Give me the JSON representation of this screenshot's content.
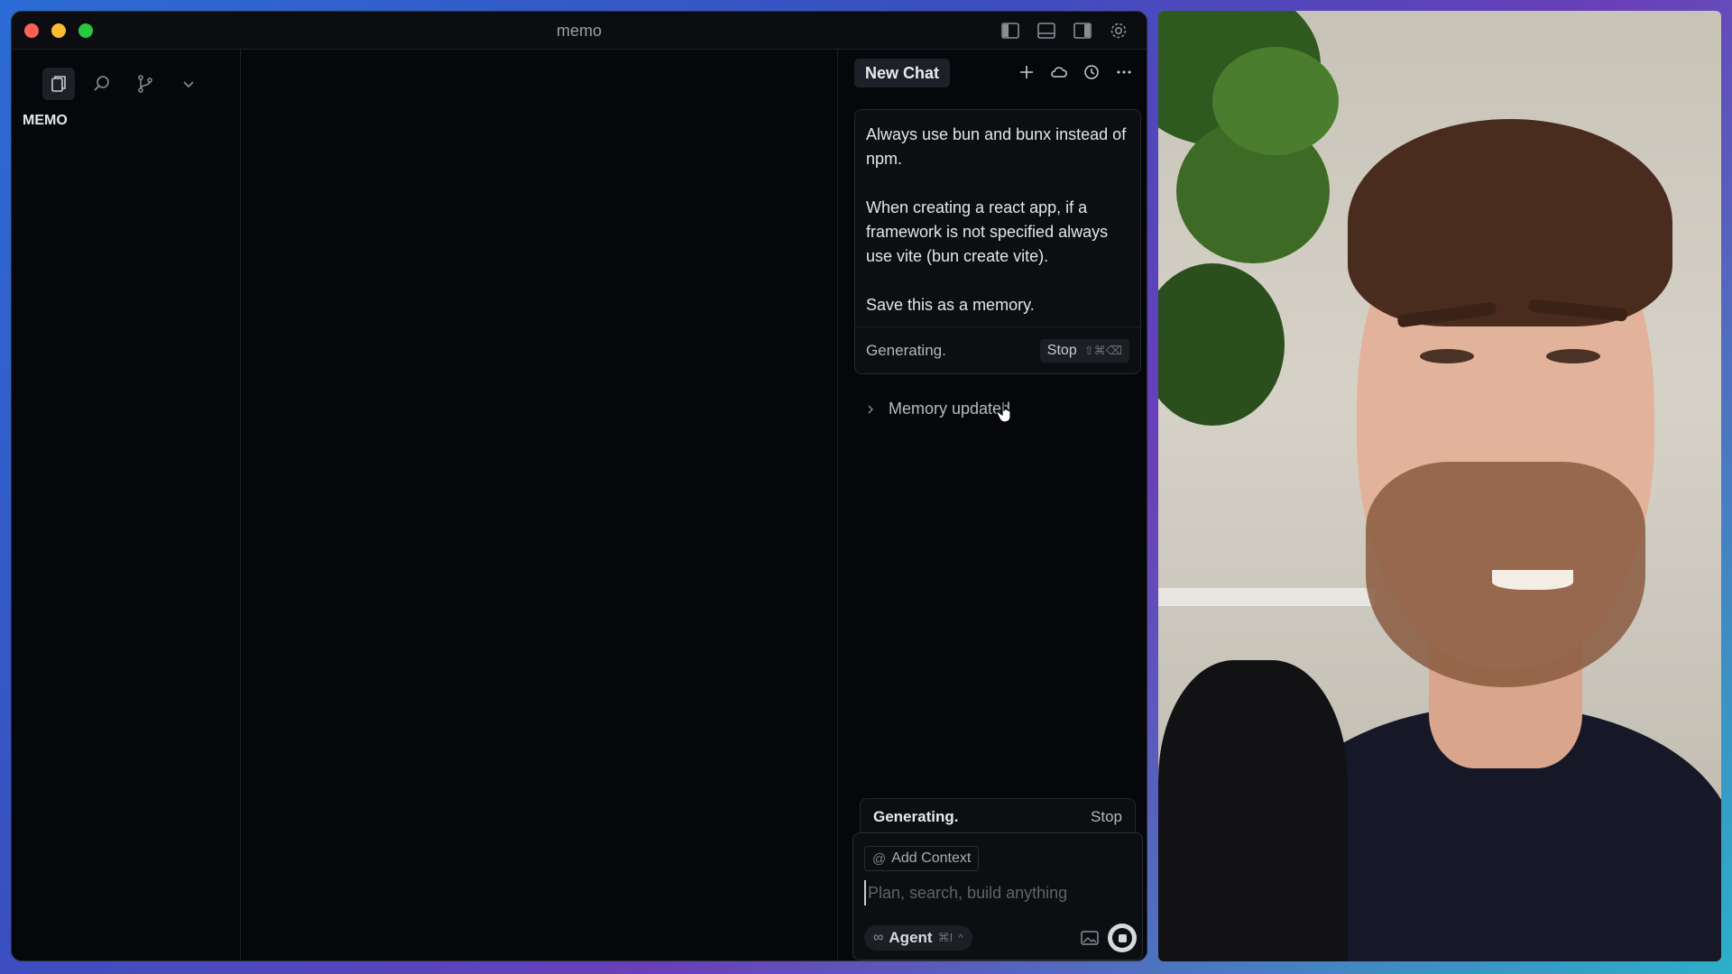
{
  "window": {
    "title": "memo"
  },
  "sidebar": {
    "section_title": "MEMO"
  },
  "chat": {
    "tab_label": "New Chat",
    "message_paragraphs": [
      "Always use bun and bunx instead of npm.",
      "When creating a react app, if a framework is not specified always use vite (bun create vite).",
      "Save this as a memory."
    ],
    "status_text": "Generating.",
    "stop_label": "Stop",
    "stop_shortcut": "⇧⌘⌫",
    "memory_label": "Memory updated",
    "bottom_status": "Generating.",
    "bottom_stop": "Stop"
  },
  "composer": {
    "add_context_label": "Add Context",
    "placeholder": "Plan, search, build anything",
    "mode_label": "Agent",
    "mode_shortcut": "⌘I"
  }
}
